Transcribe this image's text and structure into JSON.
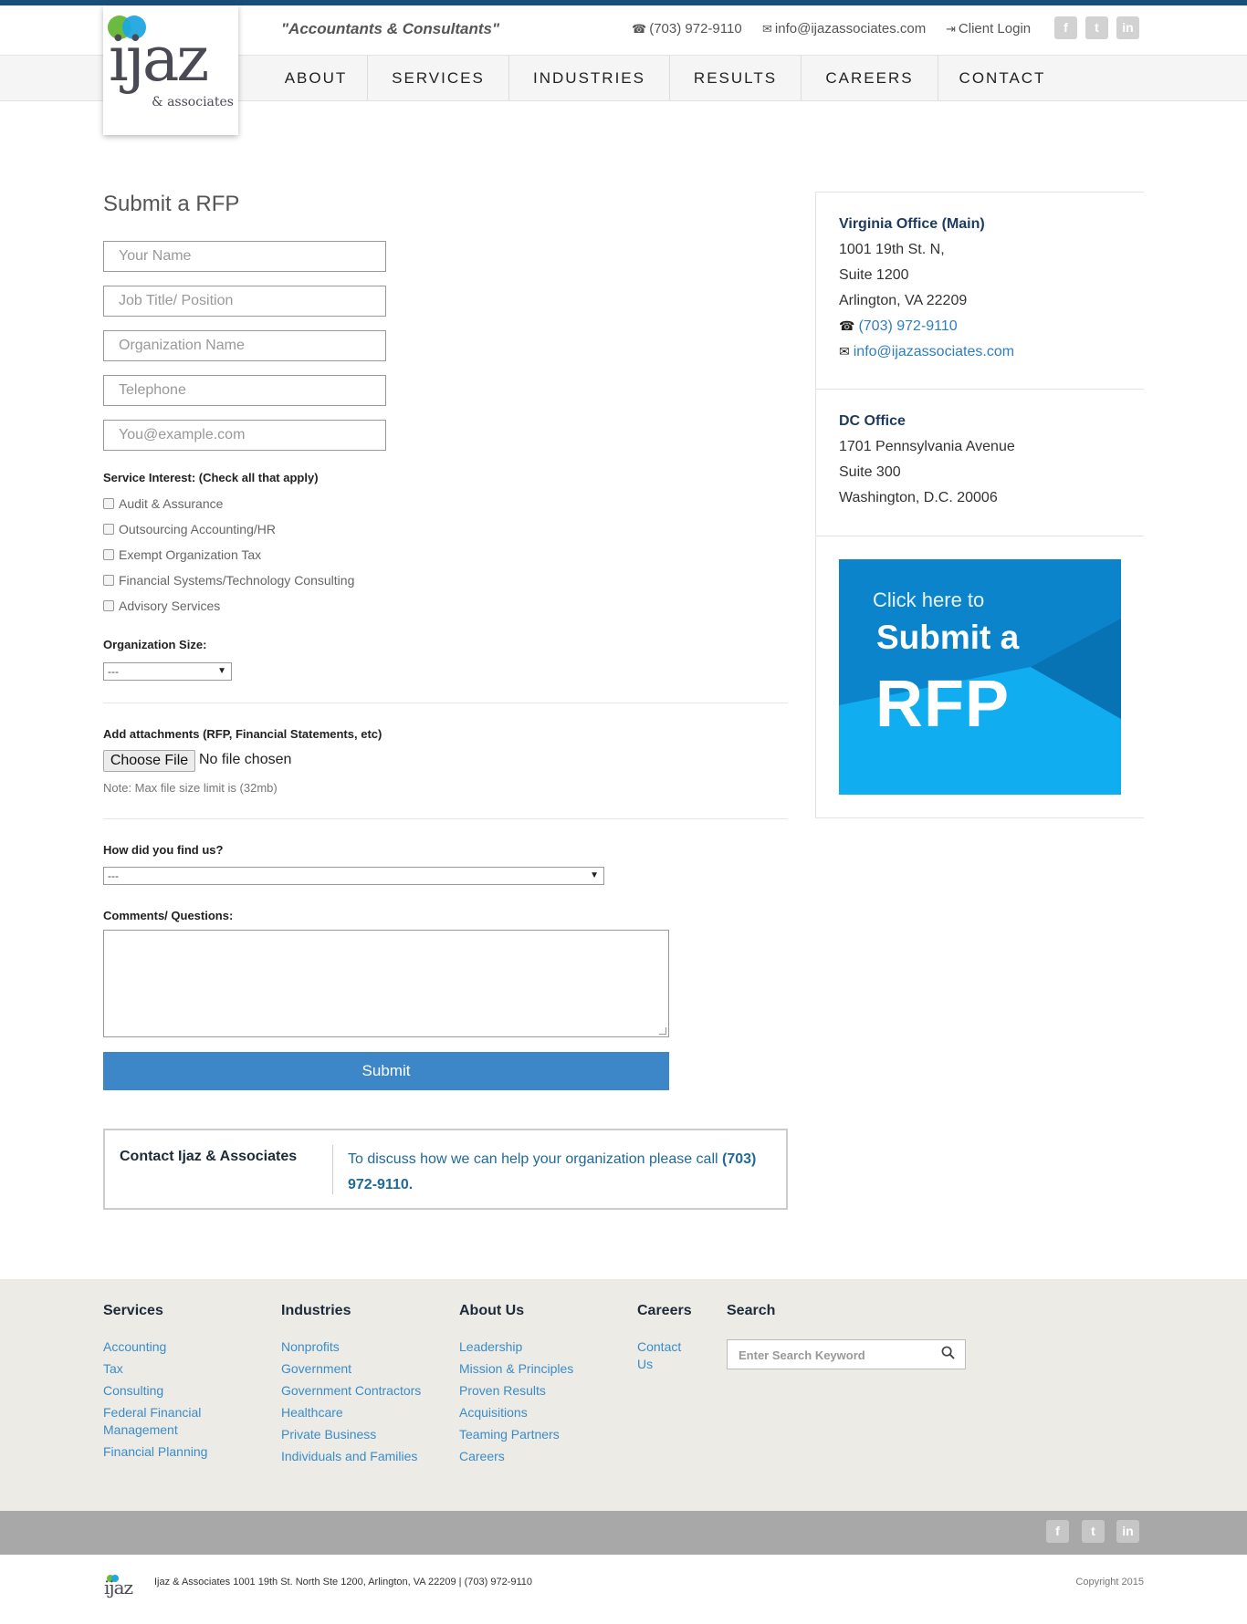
{
  "brand": {
    "logo_word": "ijaz",
    "logo_sub": "& associates",
    "tagline": "\"Accountants & Consultants\""
  },
  "topbar": {
    "phone": "(703) 972-9110",
    "email": "info@ijazassociates.com",
    "client_login": "Client Login"
  },
  "nav": {
    "items": [
      "ABOUT",
      "SERVICES",
      "INDUSTRIES",
      "RESULTS",
      "CAREERS",
      "CONTACT"
    ]
  },
  "form": {
    "title": "Submit a RFP",
    "fields": [
      {
        "placeholder": "Your Name"
      },
      {
        "placeholder": "Job Title/ Position"
      },
      {
        "placeholder": "Organization Name"
      },
      {
        "placeholder": "Telephone"
      },
      {
        "placeholder": "You@example.com"
      }
    ],
    "service_label": "Service Interest: (Check all that apply)",
    "services": [
      "Audit & Assurance",
      "Outsourcing Accounting/HR",
      "Exempt Organization Tax",
      "Financial Systems/Technology Consulting",
      "Advisory Services"
    ],
    "org_size_label": "Organization Size:",
    "org_size_value": "---",
    "attach_label": "Add attachments (RFP, Financial Statements, etc)",
    "file_button": "Choose File",
    "file_status": "No file chosen",
    "file_note": "Note: Max file size limit is (32mb)",
    "find_label": "How did you find us?",
    "find_value": "---",
    "comments_label": "Comments/ Questions:",
    "submit": "Submit"
  },
  "contact_box": {
    "title": "Contact Ijaz & Associates",
    "text": "To discuss how we can help your organization please call ",
    "phone": "(703) 972-9110."
  },
  "sidebar": {
    "va": {
      "name": "Virginia Office (Main)",
      "line1": "1001 19th St. N,",
      "line2": "Suite 1200",
      "line3": "Arlington, VA 22209",
      "phone": "(703) 972-9110",
      "email": "info@ijazassociates.com"
    },
    "dc": {
      "name": "DC Office",
      "line1": "1701 Pennsylvania Avenue",
      "line2": "Suite 300",
      "line3": "Washington, D.C. 20006"
    },
    "banner": {
      "small": "Click here to",
      "mid": "Submit a",
      "big": "RFP"
    }
  },
  "footer": {
    "services": {
      "title": "Services",
      "links": [
        "Accounting",
        "Tax",
        "Consulting",
        "Federal Financial Management",
        "Financial Planning"
      ]
    },
    "industries": {
      "title": "Industries",
      "links": [
        "Nonprofits",
        "Government",
        "Government Contractors",
        "Healthcare",
        "Private Business",
        "Individuals and Families"
      ]
    },
    "about": {
      "title": "About Us",
      "links": [
        "Leadership",
        "Mission & Principles",
        "Proven Results",
        "Acquisitions",
        "Teaming Partners",
        "Careers"
      ]
    },
    "careers": {
      "title": "Careers",
      "links": [
        "Contact Us"
      ]
    },
    "search": {
      "title": "Search",
      "placeholder": "Enter Search Keyword"
    },
    "address": "Ijaz & Associates 1001 19th St. North Ste 1200, Arlington, VA 22209 | (703) 972-9110",
    "copyright": "Copyright 2015"
  },
  "social": [
    "facebook",
    "twitter",
    "linkedin"
  ],
  "colors": {
    "accent": "#3d87c9",
    "navy": "#1d3a5f",
    "link": "#2f7dc3",
    "banner": "#0b84cc"
  }
}
